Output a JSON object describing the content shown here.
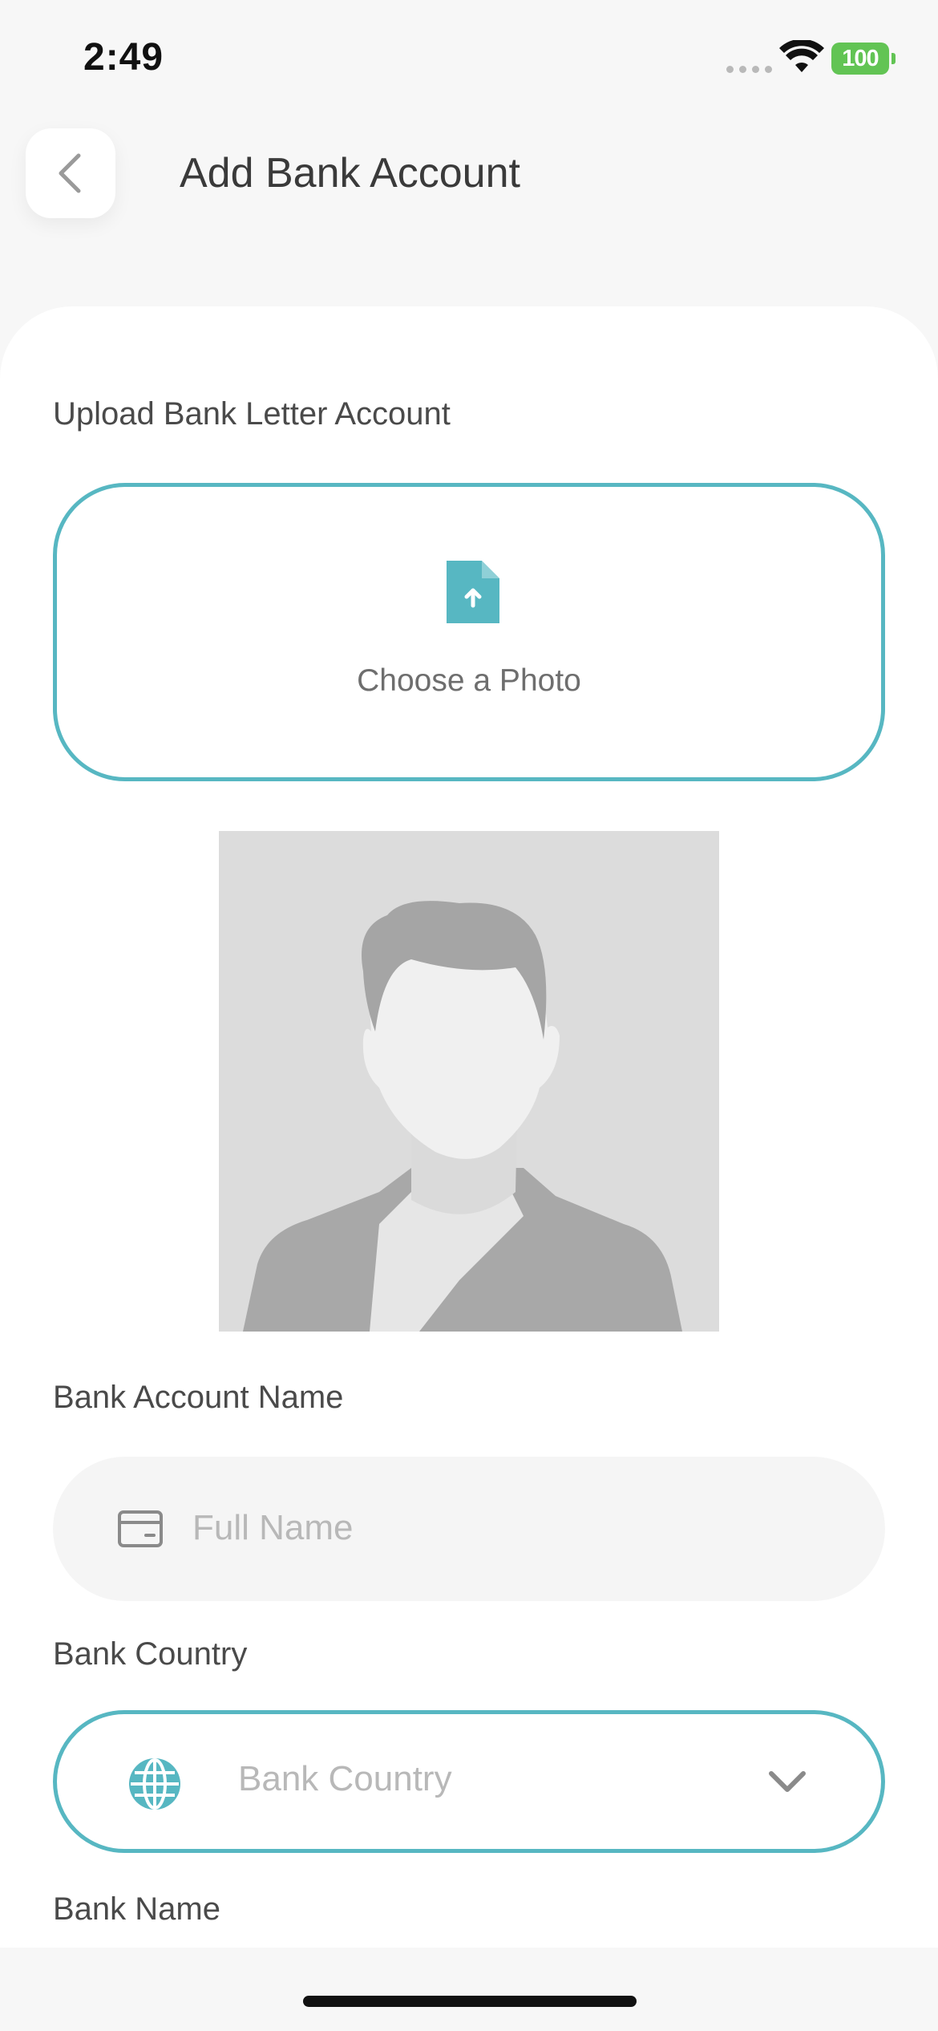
{
  "status_bar": {
    "time": "2:49",
    "battery": "100",
    "battery_color": "#62c454"
  },
  "header": {
    "title": "Add Bank Account",
    "back_icon": "chevron-left-icon"
  },
  "upload": {
    "label": "Upload Bank Letter Account",
    "button_text": "Choose a Photo",
    "icon": "file-upload-icon",
    "accent_color": "#57b7c2"
  },
  "preview": {
    "icon": "person-placeholder-icon"
  },
  "account_name": {
    "label": "Bank Account Name",
    "placeholder": "Full Name",
    "value": "",
    "icon": "card-icon"
  },
  "bank_country": {
    "label": "Bank Country",
    "placeholder": "Bank Country",
    "selected": "",
    "icon": "globe-icon",
    "dropdown_icon": "chevron-down-icon"
  },
  "bank_name": {
    "label": "Bank Name"
  }
}
